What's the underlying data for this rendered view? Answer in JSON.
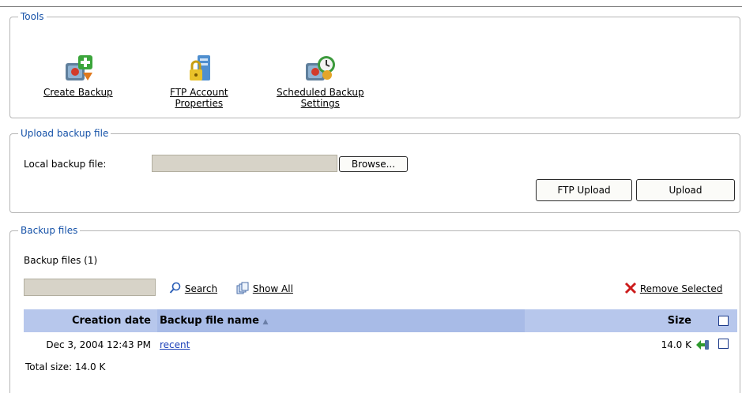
{
  "tools": {
    "legend": "Tools",
    "items": [
      {
        "label_line1": "Create Backup",
        "label_line2": "",
        "icon": "create-backup-icon"
      },
      {
        "label_line1": "FTP Account",
        "label_line2": "Properties",
        "icon": "ftp-account-icon"
      },
      {
        "label_line1": "Scheduled Backup",
        "label_line2": "Settings",
        "icon": "scheduled-backup-icon"
      }
    ]
  },
  "upload": {
    "legend": "Upload backup file",
    "local_label": "Local backup file:",
    "local_value": "",
    "browse_label": "Browse...",
    "ftp_upload_label": "FTP Upload",
    "upload_label": "Upload"
  },
  "backups": {
    "legend": "Backup files",
    "count_label": "Backup files (1)",
    "search_value": "",
    "search_label": "Search",
    "show_all_label": "Show All",
    "remove_selected_label": "Remove Selected",
    "columns": {
      "creation_date": "Creation date",
      "file_name": "Backup file name",
      "sort_indicator": "▲",
      "size": "Size"
    },
    "rows": [
      {
        "creation_date": "Dec 3, 2004 12:43 PM",
        "file_name": "recent",
        "size": "14.0 K",
        "checked": false
      }
    ],
    "total_label": "Total size: 14.0 K"
  },
  "colors": {
    "legend_text": "#1652a8",
    "header_bg": "#b7c7ec",
    "header_sorted_bg": "#a8bbe7",
    "link": "#1a3fb8",
    "remove_icon": "#cc1c1c"
  }
}
